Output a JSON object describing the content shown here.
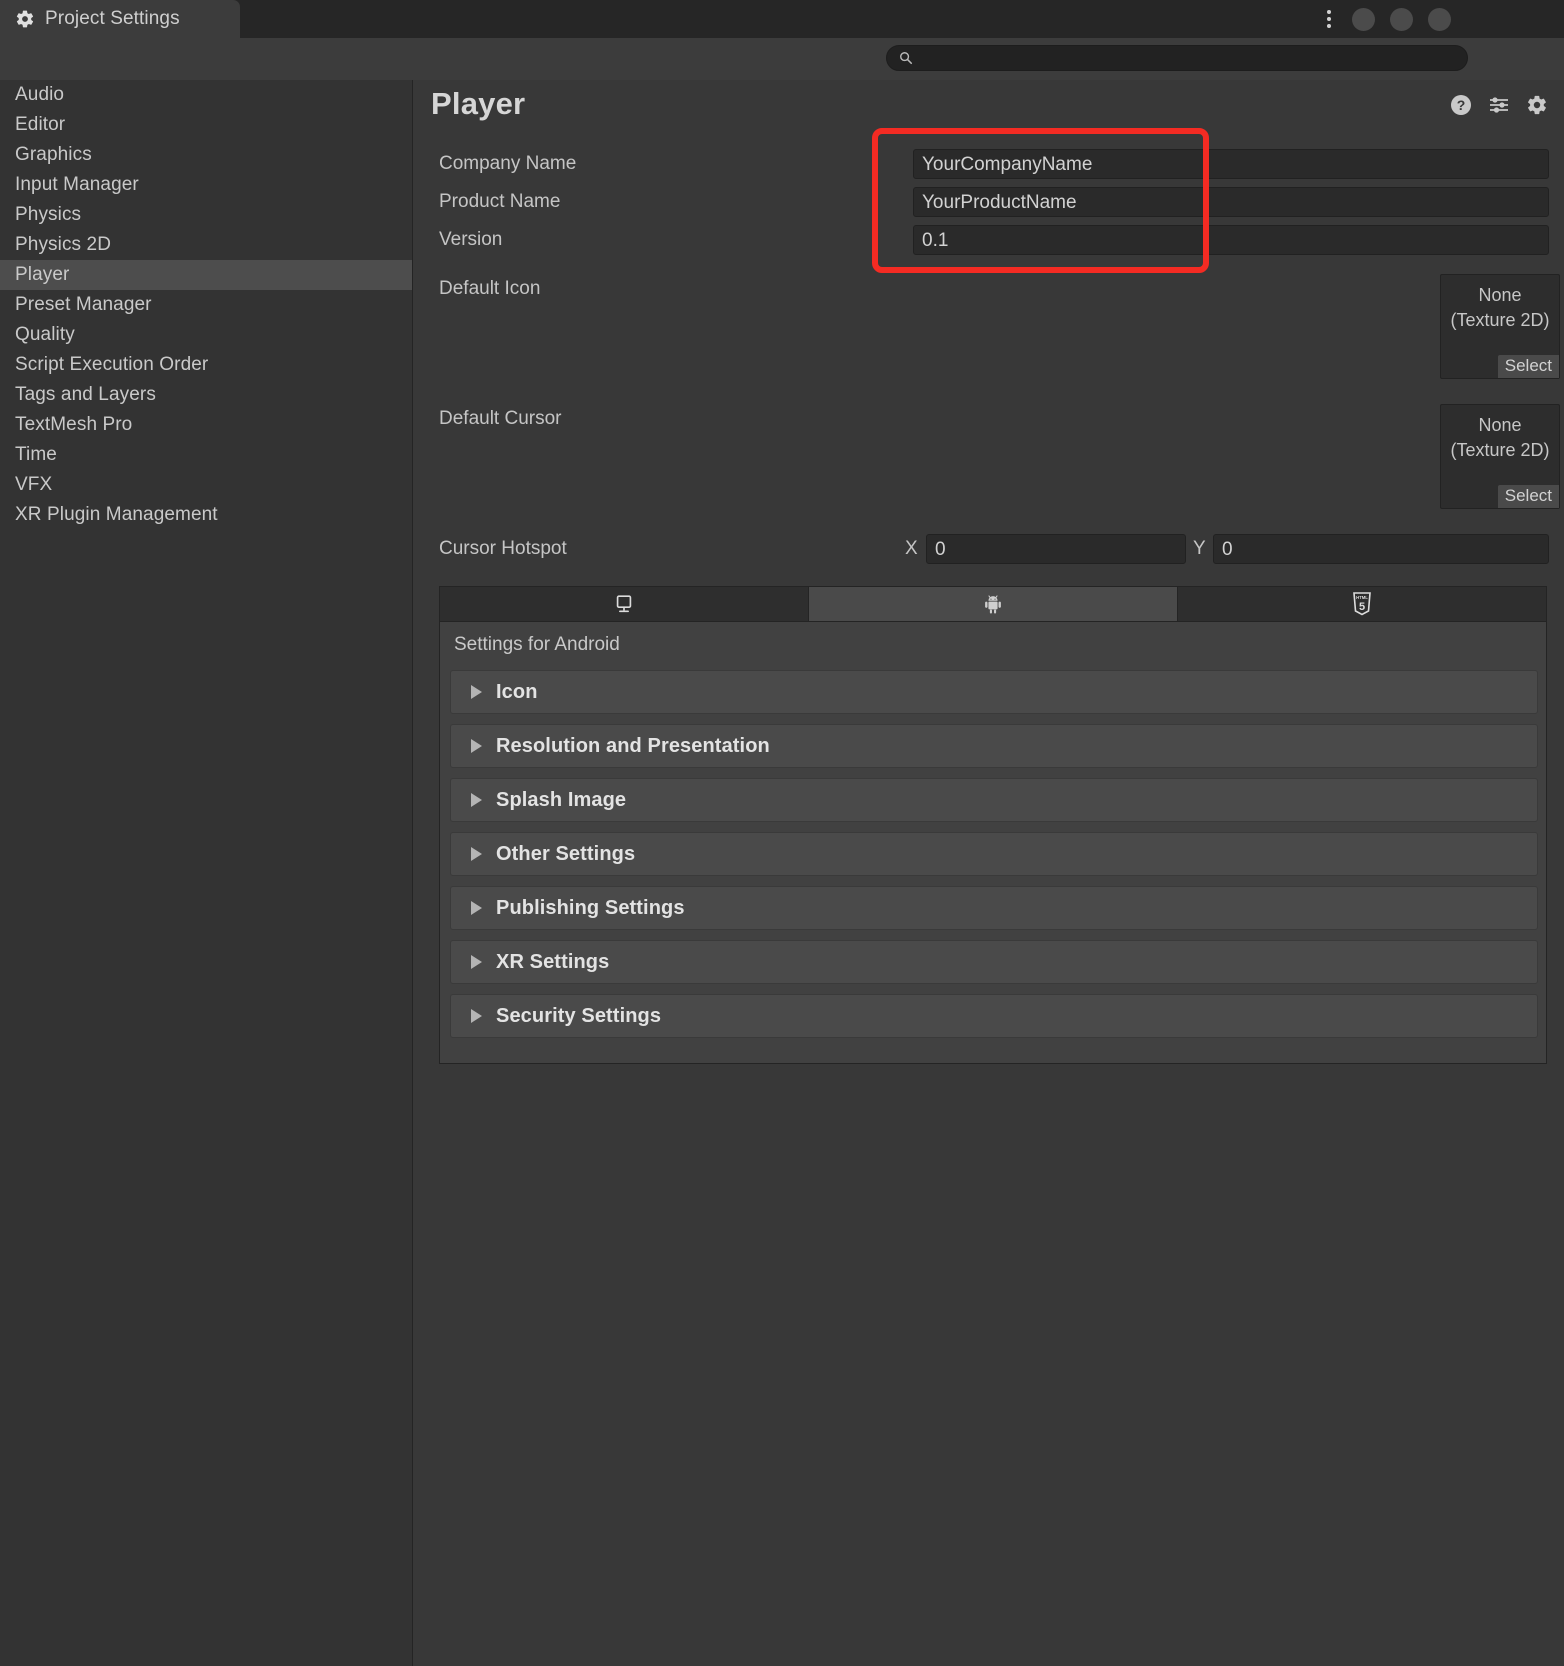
{
  "window": {
    "tab_label": "Project Settings",
    "tab_icon": "gear-icon",
    "menu_icon": "kebab-menu-icon",
    "controls": [
      "minimize-button",
      "maximize-button",
      "close-button"
    ]
  },
  "search": {
    "icon": "search-icon",
    "value": "",
    "placeholder": ""
  },
  "sidebar": {
    "items": [
      {
        "label": "Audio",
        "selected": false
      },
      {
        "label": "Editor",
        "selected": false
      },
      {
        "label": "Graphics",
        "selected": false
      },
      {
        "label": "Input Manager",
        "selected": false
      },
      {
        "label": "Physics",
        "selected": false
      },
      {
        "label": "Physics 2D",
        "selected": false
      },
      {
        "label": "Player",
        "selected": true
      },
      {
        "label": "Preset Manager",
        "selected": false
      },
      {
        "label": "Quality",
        "selected": false
      },
      {
        "label": "Script Execution Order",
        "selected": false
      },
      {
        "label": "Tags and Layers",
        "selected": false
      },
      {
        "label": "TextMesh Pro",
        "selected": false
      },
      {
        "label": "Time",
        "selected": false
      },
      {
        "label": "VFX",
        "selected": false
      },
      {
        "label": "XR Plugin Management",
        "selected": false
      }
    ]
  },
  "panel": {
    "title": "Player",
    "header_icons": [
      "help-icon",
      "preset-icon",
      "settings-gear-icon"
    ],
    "fields": [
      {
        "label": "Company Name",
        "value": "YourCompanyName"
      },
      {
        "label": "Product Name",
        "value": "YourProductName"
      },
      {
        "label": "Version",
        "value": "0.1"
      }
    ],
    "object_fields": [
      {
        "label": "Default Icon",
        "value_line1": "None",
        "value_line2": "(Texture 2D)",
        "button": "Select"
      },
      {
        "label": "Default Cursor",
        "value_line1": "None",
        "value_line2": "(Texture 2D)",
        "button": "Select"
      }
    ],
    "cursor_hotspot": {
      "label": "Cursor Hotspot",
      "x_label": "X",
      "x_value": "0",
      "y_label": "Y",
      "y_value": "0"
    },
    "platform_tabs": [
      {
        "icon": "desktop-monitor-icon",
        "active": false
      },
      {
        "icon": "android-robot-icon",
        "active": true
      },
      {
        "icon": "html5-webgl-icon",
        "active": false
      }
    ],
    "settings_for": "Settings for Android",
    "foldouts": [
      {
        "label": "Icon"
      },
      {
        "label": "Resolution and Presentation"
      },
      {
        "label": "Splash Image"
      },
      {
        "label": "Other Settings"
      },
      {
        "label": "Publishing Settings"
      },
      {
        "label": "XR Settings"
      },
      {
        "label": "Security Settings"
      }
    ]
  },
  "annotation": {
    "color": "#f42b23",
    "target": "company-product-version-fields"
  }
}
